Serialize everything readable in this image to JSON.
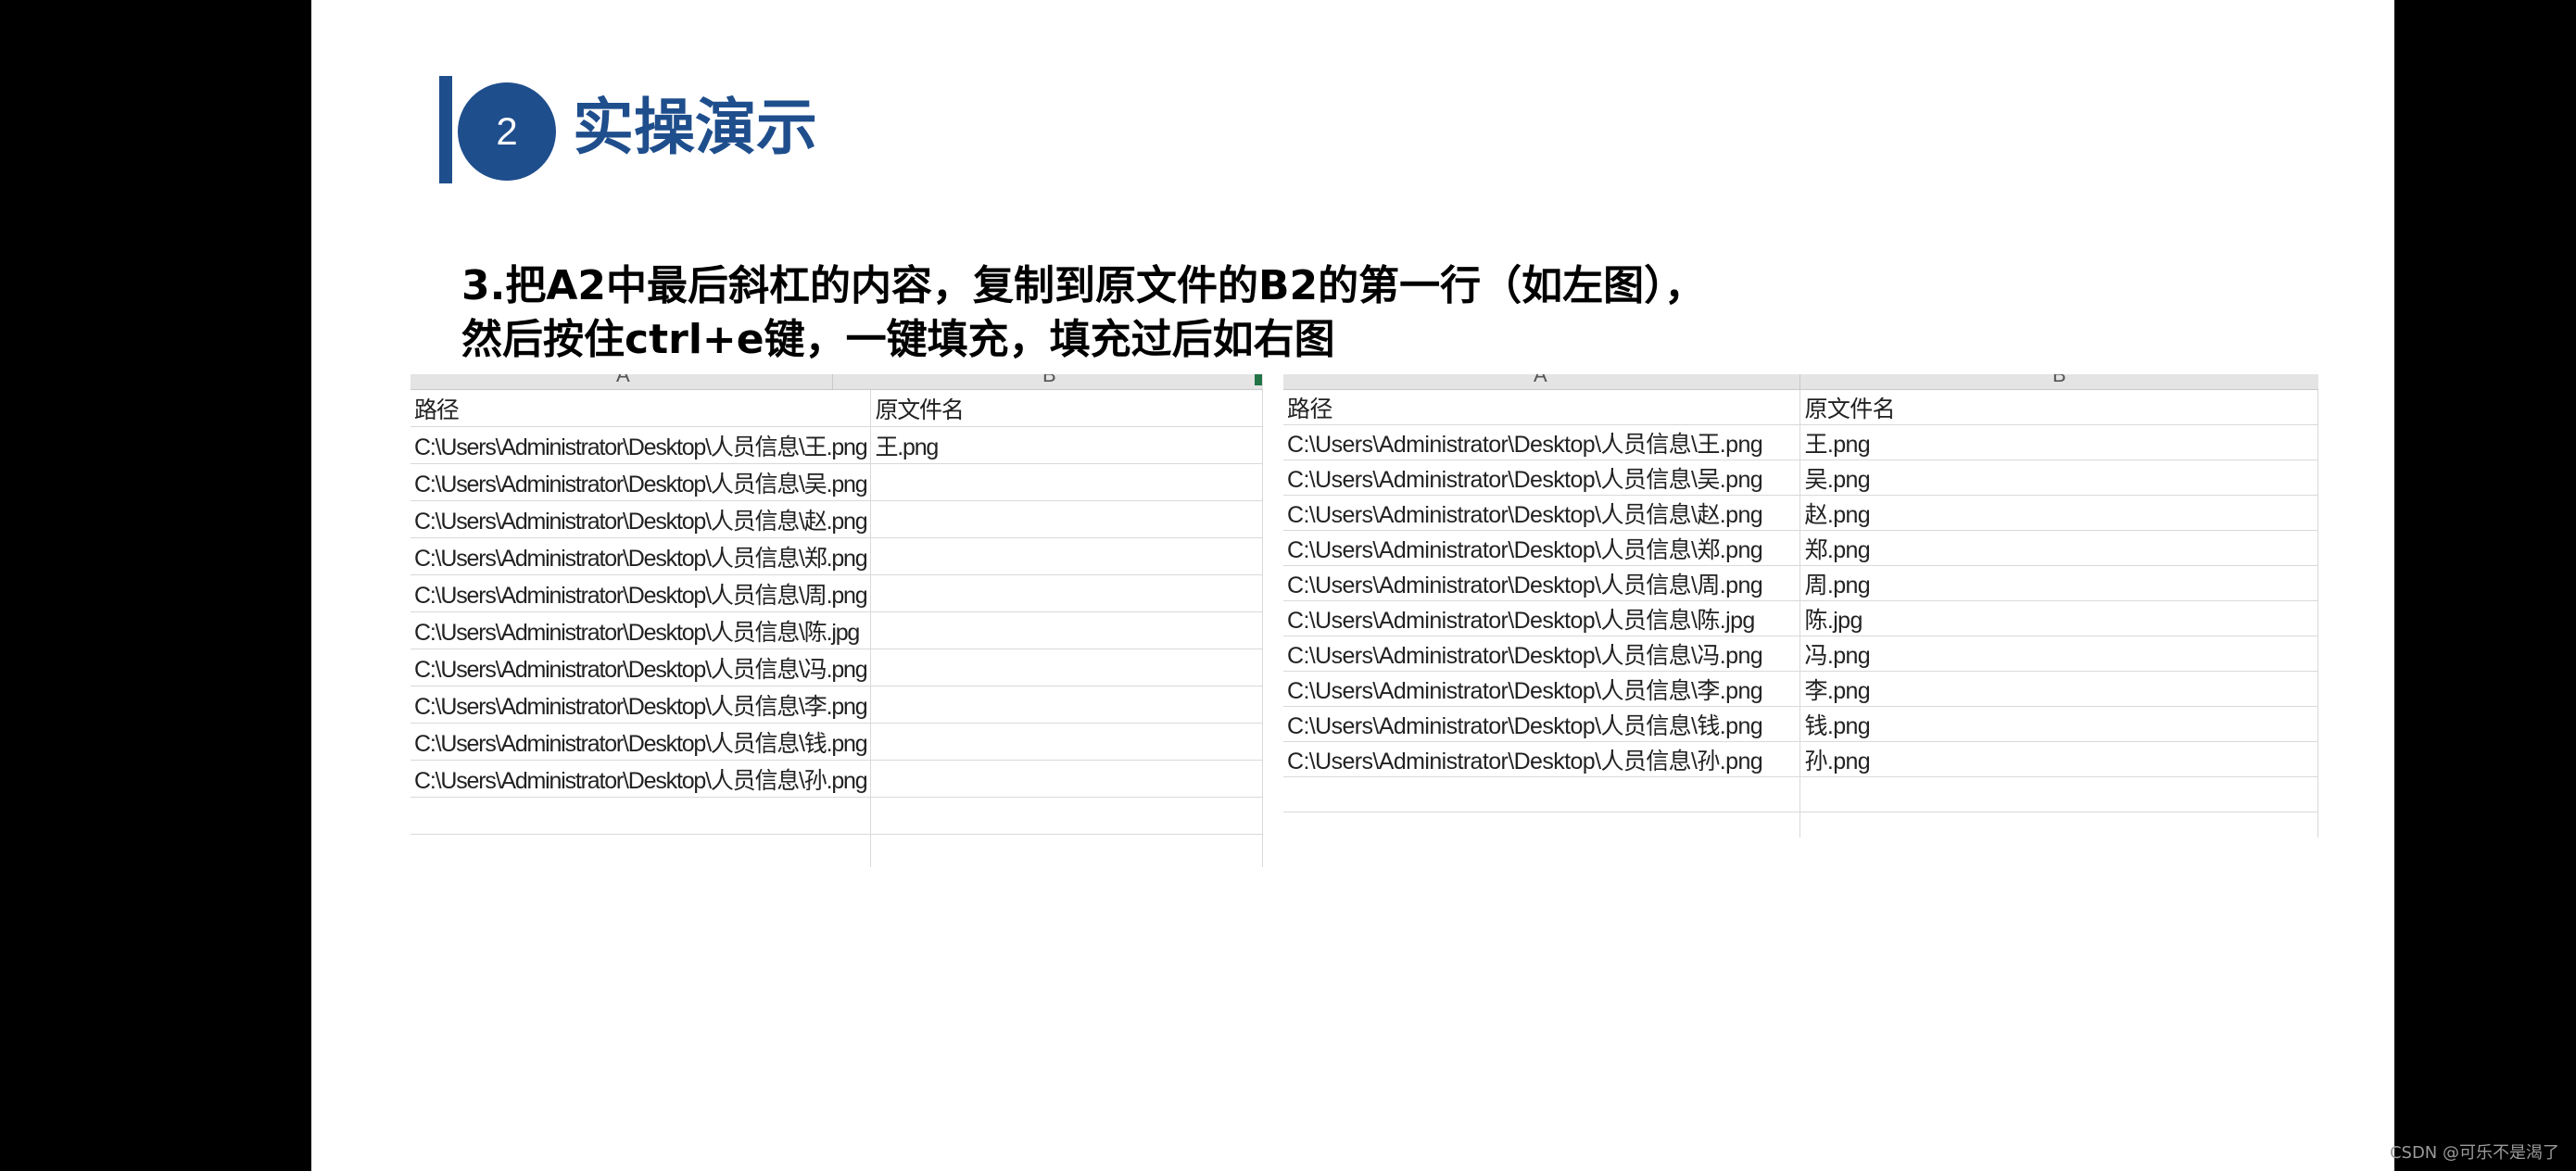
{
  "slide": {
    "section_number": "2",
    "section_title": "实操演示",
    "instruction_lines": [
      "3.把A2中最后斜杠的内容，复制到原文件的B2的第一行（如左图），",
      "然后按住ctrl+e键，一键填充，填充过后如右图"
    ]
  },
  "left_sheet": {
    "column_letters": [
      "A",
      "B"
    ],
    "headers": [
      "路径",
      "原文件名"
    ],
    "rows": [
      [
        "C:\\Users\\Administrator\\Desktop\\人员信息\\王.png",
        "王.png"
      ],
      [
        "C:\\Users\\Administrator\\Desktop\\人员信息\\吴.png",
        ""
      ],
      [
        "C:\\Users\\Administrator\\Desktop\\人员信息\\赵.png",
        ""
      ],
      [
        "C:\\Users\\Administrator\\Desktop\\人员信息\\郑.png",
        ""
      ],
      [
        "C:\\Users\\Administrator\\Desktop\\人员信息\\周.png",
        ""
      ],
      [
        "C:\\Users\\Administrator\\Desktop\\人员信息\\陈.jpg",
        ""
      ],
      [
        "C:\\Users\\Administrator\\Desktop\\人员信息\\冯.png",
        ""
      ],
      [
        "C:\\Users\\Administrator\\Desktop\\人员信息\\李.png",
        ""
      ],
      [
        "C:\\Users\\Administrator\\Desktop\\人员信息\\钱.png",
        ""
      ],
      [
        "C:\\Users\\Administrator\\Desktop\\人员信息\\孙.png",
        ""
      ],
      [
        "",
        ""
      ],
      [
        "",
        ""
      ]
    ]
  },
  "right_sheet": {
    "column_letters": [
      "A",
      "B"
    ],
    "headers": [
      "路径",
      "原文件名"
    ],
    "rows": [
      [
        "C:\\Users\\Administrator\\Desktop\\人员信息\\王.png",
        "王.png"
      ],
      [
        "C:\\Users\\Administrator\\Desktop\\人员信息\\吴.png",
        "吴.png"
      ],
      [
        "C:\\Users\\Administrator\\Desktop\\人员信息\\赵.png",
        "赵.png"
      ],
      [
        "C:\\Users\\Administrator\\Desktop\\人员信息\\郑.png",
        "郑.png"
      ],
      [
        "C:\\Users\\Administrator\\Desktop\\人员信息\\周.png",
        "周.png"
      ],
      [
        "C:\\Users\\Administrator\\Desktop\\人员信息\\陈.jpg",
        "陈.jpg"
      ],
      [
        "C:\\Users\\Administrator\\Desktop\\人员信息\\冯.png",
        "冯.png"
      ],
      [
        "C:\\Users\\Administrator\\Desktop\\人员信息\\李.png",
        "李.png"
      ],
      [
        "C:\\Users\\Administrator\\Desktop\\人员信息\\钱.png",
        "钱.png"
      ],
      [
        "C:\\Users\\Administrator\\Desktop\\人员信息\\孙.png",
        "孙.png"
      ],
      [
        "",
        ""
      ],
      [
        "",
        ""
      ]
    ]
  },
  "watermark": "CSDN @可乐不是渴了",
  "colors": {
    "accent": "#1f4e8c",
    "background": "#000000",
    "slide": "#ffffff"
  }
}
